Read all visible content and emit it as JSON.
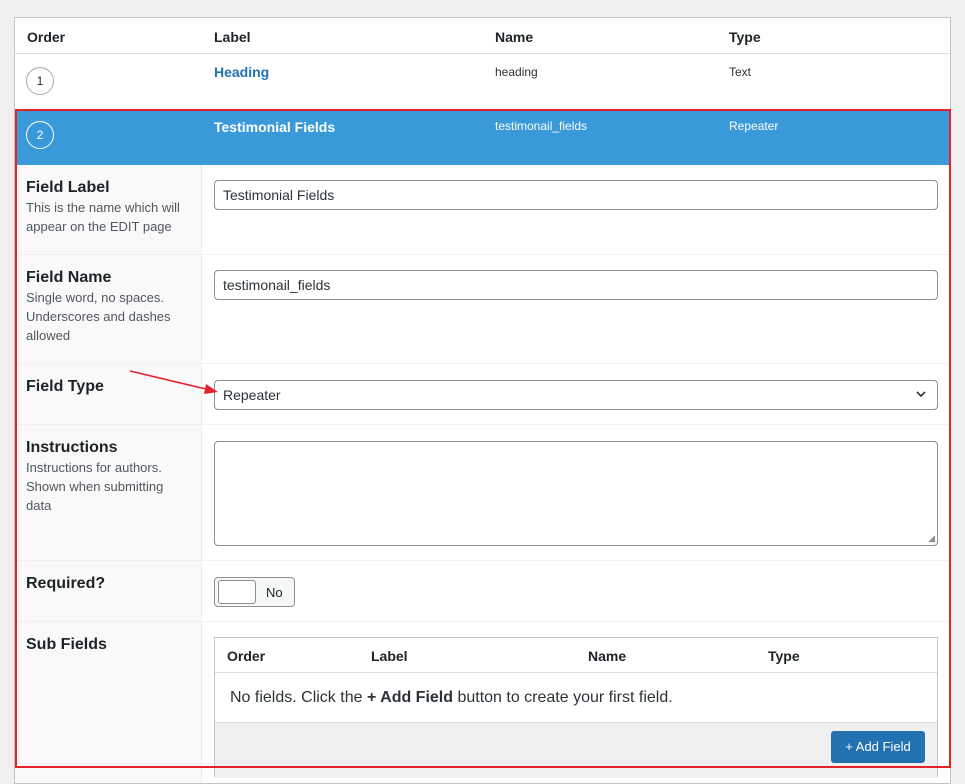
{
  "table": {
    "headers": {
      "order": "Order",
      "label": "Label",
      "name": "Name",
      "type": "Type"
    },
    "rows": [
      {
        "order": "1",
        "label": "Heading",
        "name": "heading",
        "type": "Text"
      },
      {
        "order": "2",
        "label": "Testimonial Fields",
        "name": "testimonail_fields",
        "type": "Repeater"
      }
    ]
  },
  "settings": {
    "field_label": {
      "title": "Field Label",
      "desc": "This is the name which will appear on the EDIT page",
      "value": "Testimonial Fields"
    },
    "field_name": {
      "title": "Field Name",
      "desc": "Single word, no spaces. Underscores and dashes allowed",
      "value": "testimonail_fields"
    },
    "field_type": {
      "title": "Field Type",
      "value": "Repeater"
    },
    "instructions": {
      "title": "Instructions",
      "desc": "Instructions for authors. Shown when submitting data",
      "value": ""
    },
    "required": {
      "title": "Required?",
      "toggle_text": "No"
    },
    "sub_fields": {
      "title": "Sub Fields",
      "headers": {
        "order": "Order",
        "label": "Label",
        "name": "Name",
        "type": "Type"
      },
      "empty_pre": "No fields. Click the ",
      "empty_bold": "+ Add Field",
      "empty_post": " button to create your first field.",
      "add_button": "+ Add Field"
    }
  },
  "colors": {
    "selected_row": "#3a9ad9",
    "highlight_border": "#e3232b",
    "link": "#2271b1"
  },
  "icons": {
    "select_chevron": "chevron-down-icon",
    "annotation": "red-arrow-icon"
  }
}
